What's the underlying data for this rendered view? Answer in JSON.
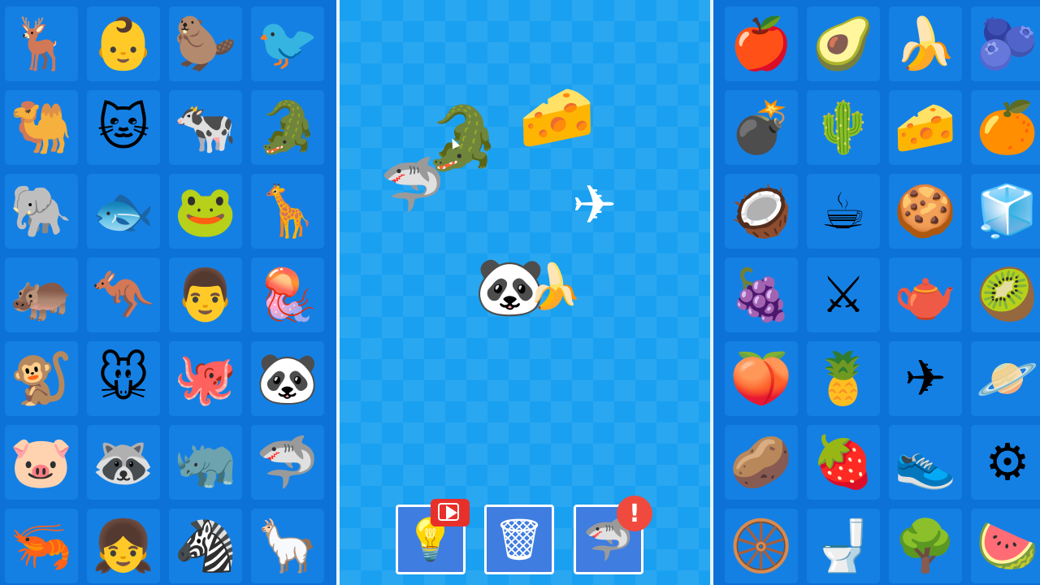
{
  "left_panel": {
    "items": [
      {
        "icon": "antelope-icon",
        "glyph": "🦌"
      },
      {
        "icon": "baby-icon",
        "glyph": "👶"
      },
      {
        "icon": "beaver-icon",
        "glyph": "🦫"
      },
      {
        "icon": "bird-icon",
        "glyph": "🐦"
      },
      {
        "icon": "camel-icon",
        "glyph": "🐫"
      },
      {
        "icon": "cat-icon",
        "glyph": "🐱"
      },
      {
        "icon": "cow-icon",
        "glyph": "🐄"
      },
      {
        "icon": "crocodile-icon",
        "glyph": "🐊"
      },
      {
        "icon": "elephant-icon",
        "glyph": "🐘"
      },
      {
        "icon": "fish-icon",
        "glyph": "🐟"
      },
      {
        "icon": "frog-icon",
        "glyph": "🐸"
      },
      {
        "icon": "giraffe-icon",
        "glyph": "🦒"
      },
      {
        "icon": "hippo-icon",
        "glyph": "🦛"
      },
      {
        "icon": "kangaroo-icon",
        "glyph": "🦘"
      },
      {
        "icon": "man-icon",
        "glyph": "👨"
      },
      {
        "icon": "jellyfish-icon",
        "glyph": "🪼"
      },
      {
        "icon": "monkey-icon",
        "glyph": "🐒"
      },
      {
        "icon": "mouse-icon",
        "glyph": "🐭"
      },
      {
        "icon": "octopus-icon",
        "glyph": "🐙"
      },
      {
        "icon": "panda-icon",
        "glyph": "🐼"
      },
      {
        "icon": "pig-icon",
        "glyph": "🐷"
      },
      {
        "icon": "raccoon-icon",
        "glyph": "🦝"
      },
      {
        "icon": "rhino-icon",
        "glyph": "🦏"
      },
      {
        "icon": "shark-icon",
        "glyph": "🦈"
      },
      {
        "icon": "shrimp-icon",
        "glyph": "🦐"
      },
      {
        "icon": "girl-icon",
        "glyph": "👧"
      },
      {
        "icon": "zebra-icon",
        "glyph": "🦓"
      },
      {
        "icon": "llama-icon",
        "glyph": "🦙"
      }
    ]
  },
  "right_panel": {
    "items": [
      {
        "icon": "apple-icon",
        "glyph": "🍎"
      },
      {
        "icon": "avocado-icon",
        "glyph": "🥑"
      },
      {
        "icon": "banana-icon",
        "glyph": "🍌"
      },
      {
        "icon": "blueberry-icon",
        "glyph": "🫐"
      },
      {
        "icon": "bomb-icon",
        "glyph": "💣"
      },
      {
        "icon": "cactus-icon",
        "glyph": "🌵"
      },
      {
        "icon": "cheese-icon",
        "glyph": "🧀"
      },
      {
        "icon": "grapefruit-icon",
        "glyph": "🍊"
      },
      {
        "icon": "coconut-icon",
        "glyph": "🥥"
      },
      {
        "icon": "coffee-cup-icon",
        "glyph": "☕"
      },
      {
        "icon": "cookie-icon",
        "glyph": "🍪"
      },
      {
        "icon": "refrigerator-icon",
        "glyph": "🧊"
      },
      {
        "icon": "grapes-icon",
        "glyph": "🍇"
      },
      {
        "icon": "weapons-icon",
        "glyph": "⚔"
      },
      {
        "icon": "teapot-icon",
        "glyph": "🫖"
      },
      {
        "icon": "kiwi-icon",
        "glyph": "🥝"
      },
      {
        "icon": "peach-icon",
        "glyph": "🍑"
      },
      {
        "icon": "pineapple-icon",
        "glyph": "🍍"
      },
      {
        "icon": "airplane-icon",
        "glyph": "✈"
      },
      {
        "icon": "planet-icon",
        "glyph": "🪐"
      },
      {
        "icon": "potato-icon",
        "glyph": "🥔"
      },
      {
        "icon": "raspberry-icon",
        "glyph": "🍓"
      },
      {
        "icon": "sneaker-icon",
        "glyph": "👟"
      },
      {
        "icon": "gears-icon",
        "glyph": "⚙"
      },
      {
        "icon": "tire-icon",
        "glyph": "🛞"
      },
      {
        "icon": "toilet-icon",
        "glyph": "🚽"
      },
      {
        "icon": "tree-icon",
        "glyph": "🌳"
      },
      {
        "icon": "watermelon-icon",
        "glyph": "🍉"
      }
    ]
  },
  "board": {
    "pieces": {
      "crocodile": {
        "icon": "crocodile-icon",
        "glyph": "🐊"
      },
      "cheese_crocodile": {
        "icon": "cheese-crocodile-icon",
        "glyph": "🧀"
      },
      "shark": {
        "icon": "shark-icon",
        "glyph": "🦈"
      },
      "airplane": {
        "icon": "airplane-icon",
        "glyph": "✈"
      },
      "panda": {
        "icon": "panda-icon",
        "glyph": "🐼"
      },
      "banana": {
        "icon": "banana-icon",
        "glyph": "🍌"
      }
    }
  },
  "toolbar": {
    "hint": {
      "icon": "lightbulb-icon",
      "glyph": "💡",
      "badge_icon": "video-ad-icon"
    },
    "delete": {
      "icon": "trash-icon",
      "glyph": "🗑"
    },
    "shark_action": {
      "icon": "shark-icon",
      "glyph": "🦈",
      "badge_icon": "alert-icon",
      "badge_text": "!"
    }
  },
  "colors": {
    "panel_bg": "#0c72d8",
    "cell_bg": "#1580e4",
    "board_bg": "#1aa0f0",
    "divider": "#e9f4ff",
    "alert_red": "#f04a3e",
    "video_red": "#e8302a"
  }
}
